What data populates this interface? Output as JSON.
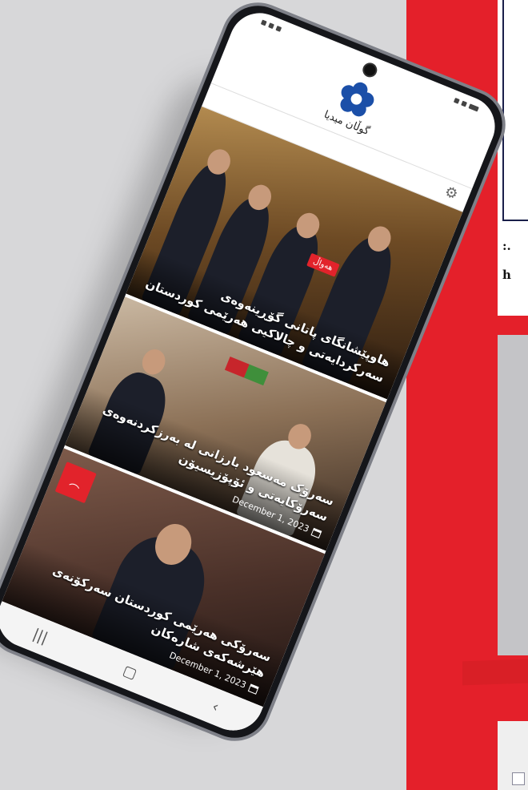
{
  "site": {
    "logo_text": "گوڵان میدیا"
  },
  "articles": [
    {
      "headline": "هاوپێشانگای پاتانی گۆڕینەوەی سەرکردایەتی و چالاکیی هەرێمی کوردستان",
      "badge": "هەواڵ",
      "date": ""
    },
    {
      "headline": "سەرۆک مەسعود بارزانی لە بەرزکردنەوەی سەرۆکایەتی و ئۆپۆزیسیۆن",
      "badge": "",
      "date": "December 1, 2023"
    },
    {
      "headline": "سەرۆکی هەرێمی کوردستان سەرکۆنەی هێرشەکەی شارەکان",
      "badge": "",
      "date": "December 1, 2023"
    }
  ],
  "background": {
    "snippet_1": ":.",
    "snippet_2": "h"
  },
  "icons": {
    "settings": "gear-icon",
    "calendar": "calendar-icon",
    "logo": "flower-logo-icon"
  },
  "colors": {
    "accent_red": "#e4202a",
    "logo_blue": "#1b4fa8"
  }
}
